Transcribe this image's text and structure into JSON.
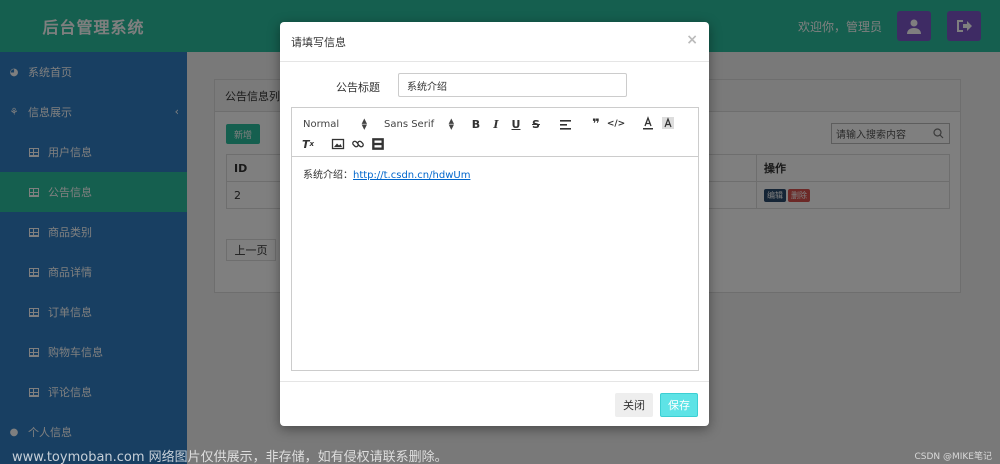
{
  "app": {
    "title": "后台管理系统"
  },
  "header": {
    "welcome": "欢迎你，管理员"
  },
  "sidebar": {
    "items": [
      {
        "label": "系统首页",
        "level": "top",
        "icon": "dashboard-icon"
      },
      {
        "label": "信息展示",
        "level": "top",
        "icon": "sitemap-icon",
        "expanded": true
      },
      {
        "label": "用户信息",
        "level": "sub",
        "icon": "table-icon"
      },
      {
        "label": "公告信息",
        "level": "sub",
        "icon": "table-icon",
        "active": true
      },
      {
        "label": "商品类别",
        "level": "sub",
        "icon": "table-icon"
      },
      {
        "label": "商品详情",
        "level": "sub",
        "icon": "table-icon"
      },
      {
        "label": "订单信息",
        "level": "sub",
        "icon": "table-icon"
      },
      {
        "label": "购物车信息",
        "level": "sub",
        "icon": "table-icon"
      },
      {
        "label": "评论信息",
        "level": "sub",
        "icon": "table-icon"
      },
      {
        "label": "个人信息",
        "level": "top",
        "icon": "user-icon"
      }
    ]
  },
  "panel": {
    "title": "公告信息列表",
    "add_label": "新增",
    "search_placeholder": "请输入搜索内容",
    "columns": [
      "ID",
      "操作"
    ],
    "rows": [
      {
        "id": "2",
        "edit": "编辑",
        "delete": "删除"
      }
    ],
    "prev_label": "上一页"
  },
  "modal": {
    "title": "请填写信息",
    "close_glyph": "×",
    "field_label": "公告标题",
    "field_value": "系统介绍",
    "toolbar": {
      "format": "Normal",
      "font": "Sans Serif"
    },
    "content_prefix": "系统介绍：",
    "content_link": "http://t.csdn.cn/hdwUm",
    "close_label": "关闭",
    "save_label": "保存"
  },
  "watermark": "www.toymoban.com 网络图片仅供展示，非存储，如有侵权请联系删除。",
  "csdn_mark": "CSDN @MIKE笔记",
  "colors": {
    "teal": "#2bbf9e",
    "sidebar": "#317fc5",
    "purple": "#7c57c9",
    "save": "#5ee3e6"
  }
}
